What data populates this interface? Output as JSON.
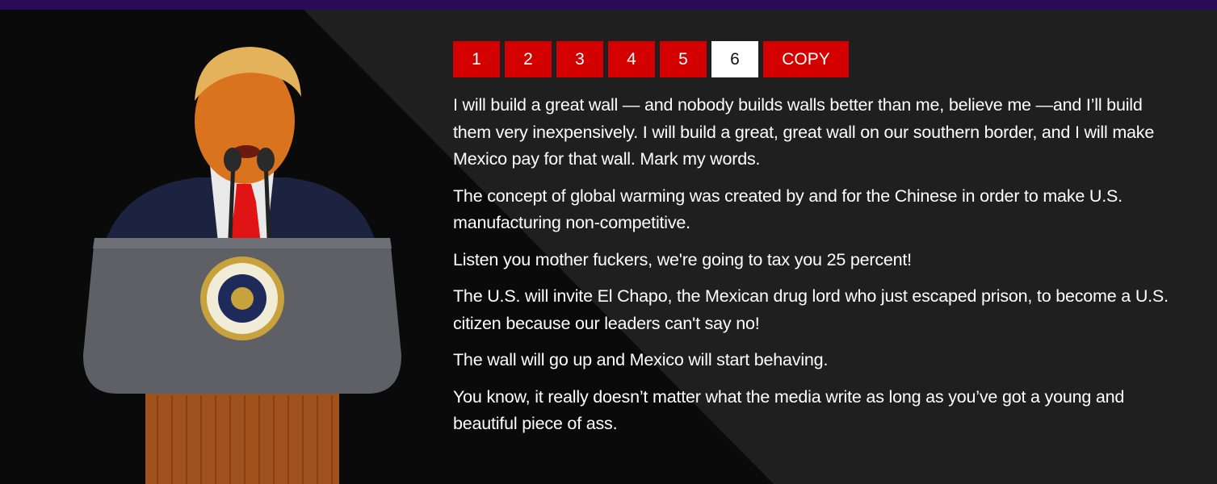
{
  "pager": {
    "pages": [
      "1",
      "2",
      "3",
      "4",
      "5",
      "6"
    ],
    "active_page": "6",
    "copy_label": "COPY"
  },
  "quotes": [
    "I will build a great wall — and nobody builds walls better than me, believe me —and I’ll build them very inexpensively. I will build a great, great wall on our southern border, and I will make Mexico pay for that wall. Mark my words.",
    "The concept of global warming was created by and for the Chinese in order to make U.S. manufacturing non-competitive.",
    "Listen you mother fuckers, we're going to tax you 25 percent!",
    "The U.S. will invite El Chapo, the Mexican drug lord who just escaped prison, to become a U.S. citizen because our leaders can't say no!",
    "The wall will go up and Mexico will start behaving.",
    "You know, it really doesn’t matter what the media write as long as you’ve got a young and beautiful piece of ass."
  ],
  "colors": {
    "accent": "#d40000",
    "top_bar": "#2a0b57",
    "background": "#0b0b0b"
  },
  "image": {
    "name": "speaker-at-podium-image"
  }
}
